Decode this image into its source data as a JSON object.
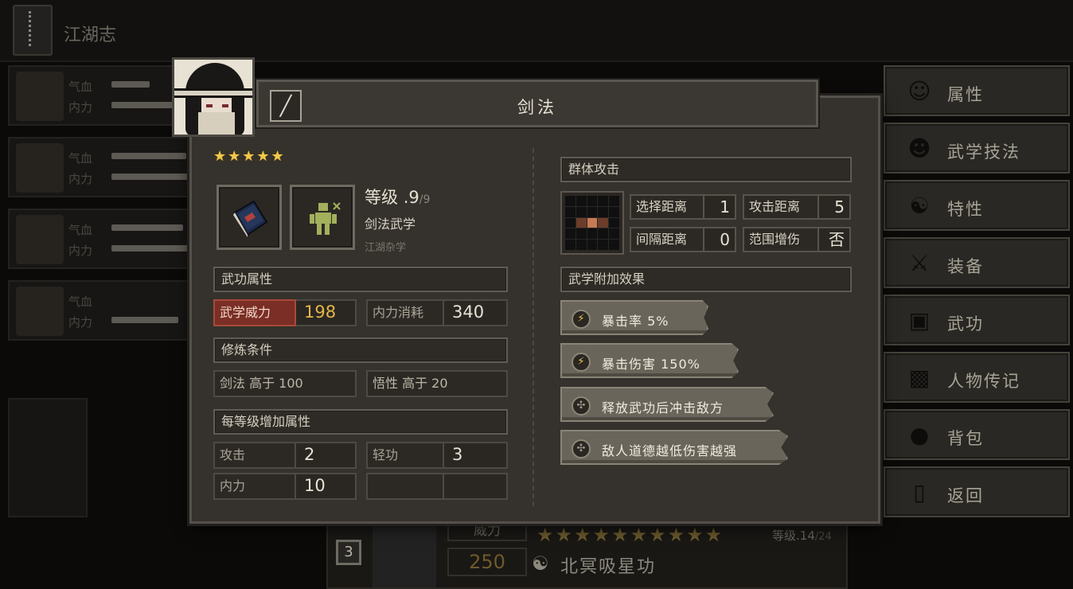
{
  "header": {
    "title": "江湖志"
  },
  "party": [
    {
      "hp_label": "气血",
      "mp_label": "内力",
      "hp_fill": 0.4,
      "mp_fill": 0.8
    },
    {
      "hp_label": "气血",
      "mp_label": "内力",
      "hp_fill": 0.75,
      "mp_fill": 0.8
    },
    {
      "hp_label": "气血",
      "mp_label": "内力",
      "hp_fill": 0.7,
      "mp_fill": 0.8
    },
    {
      "hp_label": "气血",
      "mp_label": "内力",
      "hp_fill": 0.0,
      "mp_fill": 0.65
    }
  ],
  "sidebar": {
    "items": [
      {
        "label": "属性",
        "icon": "person-icon"
      },
      {
        "label": "武学技法",
        "icon": "martial-technique-icon"
      },
      {
        "label": "特性",
        "icon": "trait-icon"
      },
      {
        "label": "装备",
        "icon": "sword-icon"
      },
      {
        "label": "武功",
        "icon": "book-icon"
      },
      {
        "label": "人物传记",
        "icon": "scroll-icon"
      },
      {
        "label": "背包",
        "icon": "bag-icon"
      },
      {
        "label": "返回",
        "icon": "door-icon"
      }
    ]
  },
  "bottom_skill": {
    "slot": "3",
    "power_label": "威力",
    "power_value": "250",
    "stars": "★★★★★★★★★★",
    "level_text": "等级",
    "level_value": ".14",
    "level_max": "/24",
    "name": "北冥吸星功"
  },
  "dialog": {
    "title": "剑法",
    "stars": "★★★★★",
    "level_label": "等级",
    "level_value": ".9",
    "level_max": "/9",
    "skill_type": "剑法武学",
    "source": "江湖杂学",
    "attr_header": "武功属性",
    "power_label": "武学威力",
    "power_value": "198",
    "mp_cost_label": "内力消耗",
    "mp_cost_value": "340",
    "req_header": "修炼条件",
    "req1": "剑法 高于 100",
    "req2": "悟性 高于 20",
    "perlevel_header": "每等级增加属性",
    "perlevel": [
      {
        "label": "攻击",
        "value": "2"
      },
      {
        "label": "轻功",
        "value": "3"
      },
      {
        "label": "内力",
        "value": "10"
      }
    ],
    "aoe_header": "群体攻击",
    "select_range_label": "选择距离",
    "select_range_value": "1",
    "attack_range_label": "攻击距离",
    "attack_range_value": "5",
    "interval_label": "间隔距离",
    "interval_value": "0",
    "aoe_bonus_label": "范围增伤",
    "aoe_bonus_value": "否",
    "effects_header": "武学附加效果",
    "effects": [
      {
        "text": "暴击率 5%",
        "icon": "lightning-icon"
      },
      {
        "text": "暴击伤害 150%",
        "icon": "lightning-icon"
      },
      {
        "text": "释放武功后冲击敌方",
        "icon": "compass-icon"
      },
      {
        "text": "敌人道德越低伤害越强",
        "icon": "compass-icon"
      }
    ]
  },
  "colors": {
    "accent_gold": "#e6b54a",
    "power_red": "#7a2e25",
    "star": "#f2c94c"
  }
}
